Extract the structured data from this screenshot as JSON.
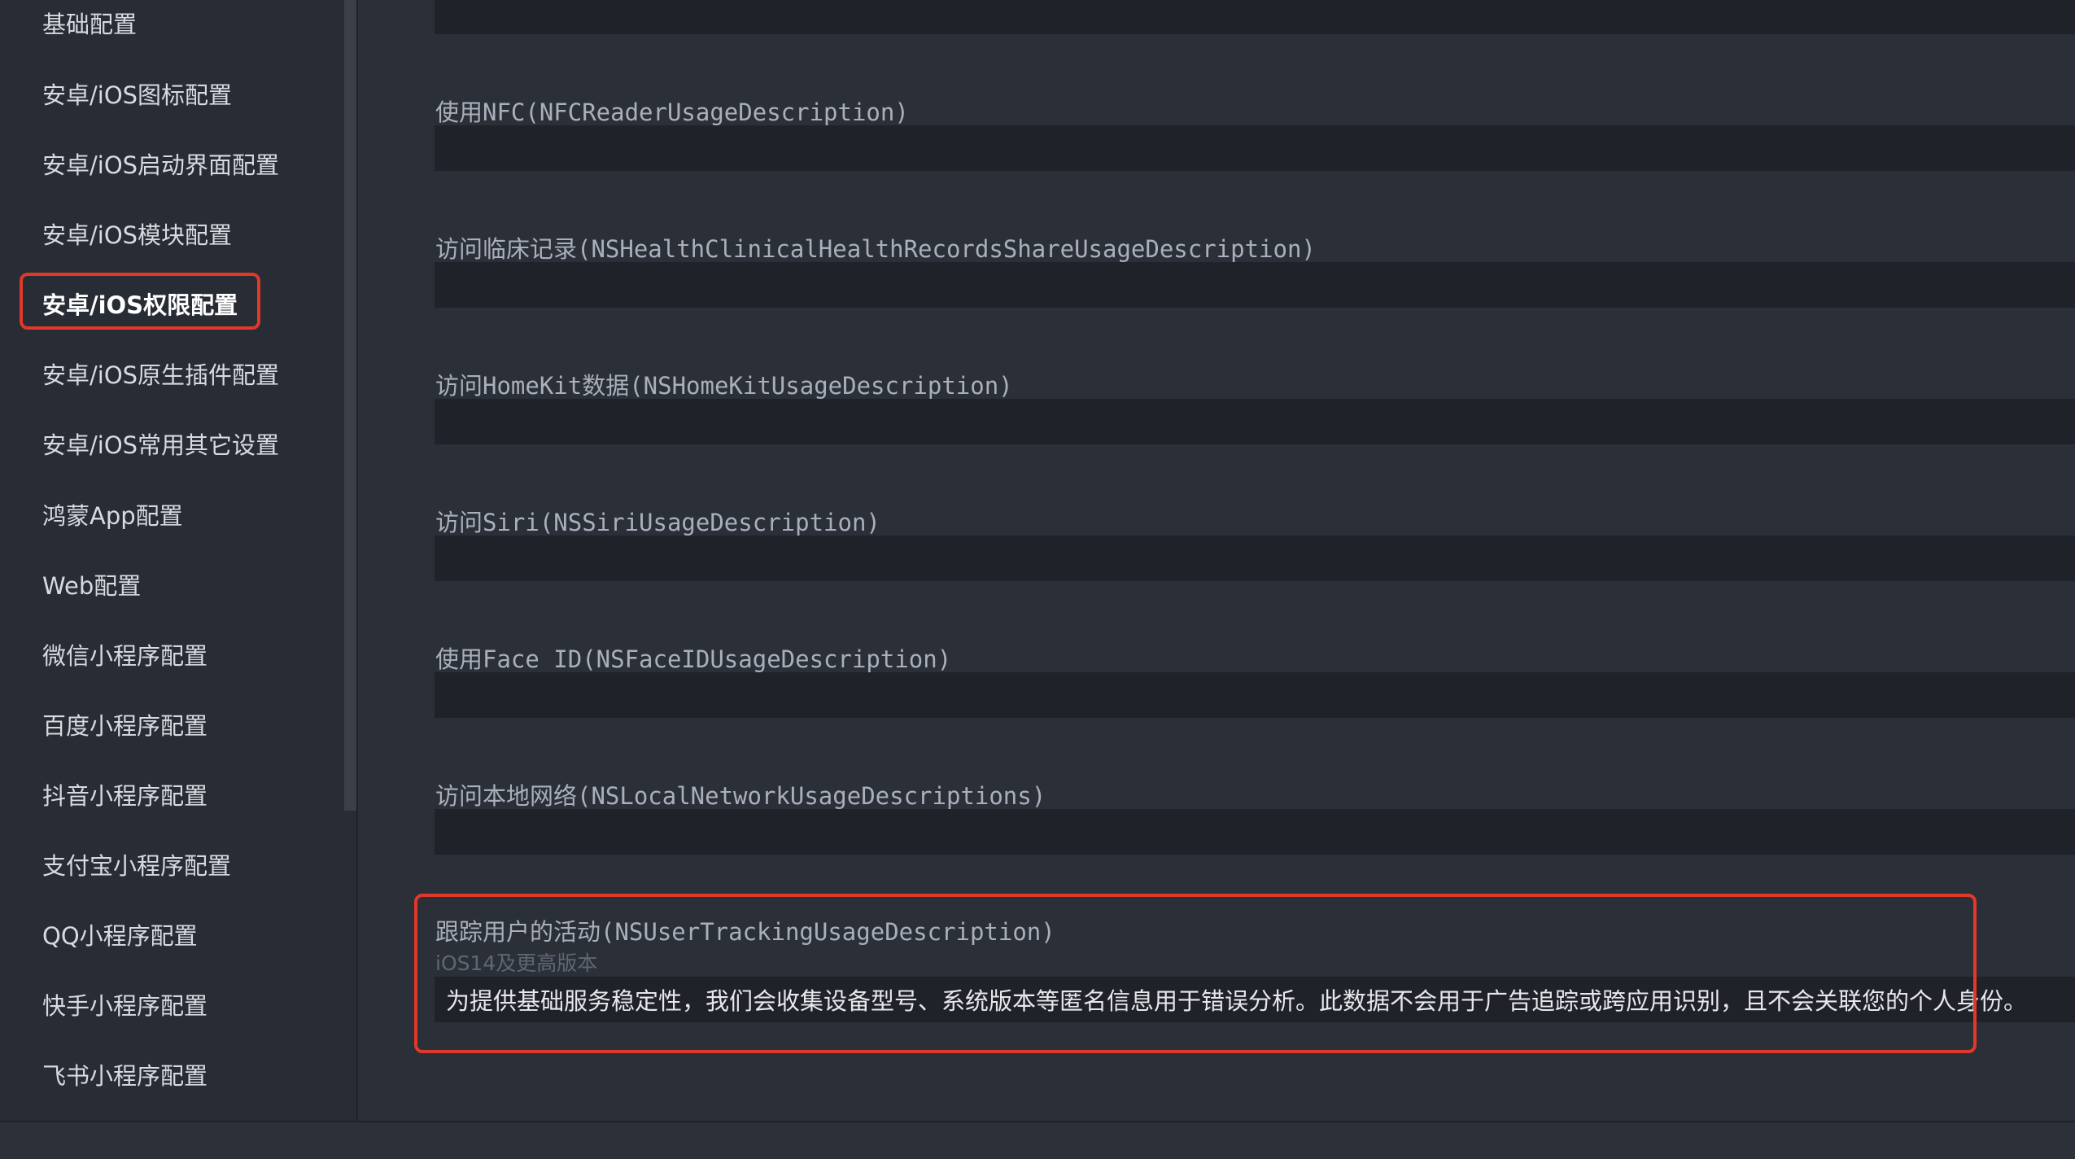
{
  "sidebar": {
    "items": [
      {
        "label": "基础配置"
      },
      {
        "label": "安卓/iOS图标配置"
      },
      {
        "label": "安卓/iOS启动界面配置"
      },
      {
        "label": "安卓/iOS模块配置"
      },
      {
        "label": "安卓/iOS权限配置",
        "active": true
      },
      {
        "label": "安卓/iOS原生插件配置"
      },
      {
        "label": "安卓/iOS常用其它设置"
      },
      {
        "label": "鸿蒙App配置"
      },
      {
        "label": "Web配置"
      },
      {
        "label": "微信小程序配置"
      },
      {
        "label": "百度小程序配置"
      },
      {
        "label": "抖音小程序配置"
      },
      {
        "label": "支付宝小程序配置"
      },
      {
        "label": "QQ小程序配置"
      },
      {
        "label": "快手小程序配置"
      },
      {
        "label": "飞书小程序配置"
      }
    ]
  },
  "fields": [
    {
      "label": "使用NFC(NFCReaderUsageDescription)",
      "value": ""
    },
    {
      "label": "访问临床记录(NSHealthClinicalHealthRecordsShareUsageDescription)",
      "value": ""
    },
    {
      "label": "访问HomeKit数据(NSHomeKitUsageDescription)",
      "value": ""
    },
    {
      "label": "访问Siri(NSSiriUsageDescription)",
      "value": ""
    },
    {
      "label": "使用Face ID(NSFaceIDUsageDescription)",
      "value": ""
    },
    {
      "label": "访问本地网络(NSLocalNetworkUsageDescriptions)",
      "value": ""
    },
    {
      "label": "跟踪用户的活动(NSUserTrackingUsageDescription)",
      "hint": "iOS14及更高版本",
      "value": "为提供基础服务稳定性，我们会收集设备型号、系统版本等匿名信息用于错误分析。此数据不会用于广告追踪或跨应用识别，且不会关联您的个人身份。"
    }
  ],
  "colors": {
    "highlight": "#e0382a",
    "background": "#2b2f38",
    "input_background": "#1f2228"
  }
}
